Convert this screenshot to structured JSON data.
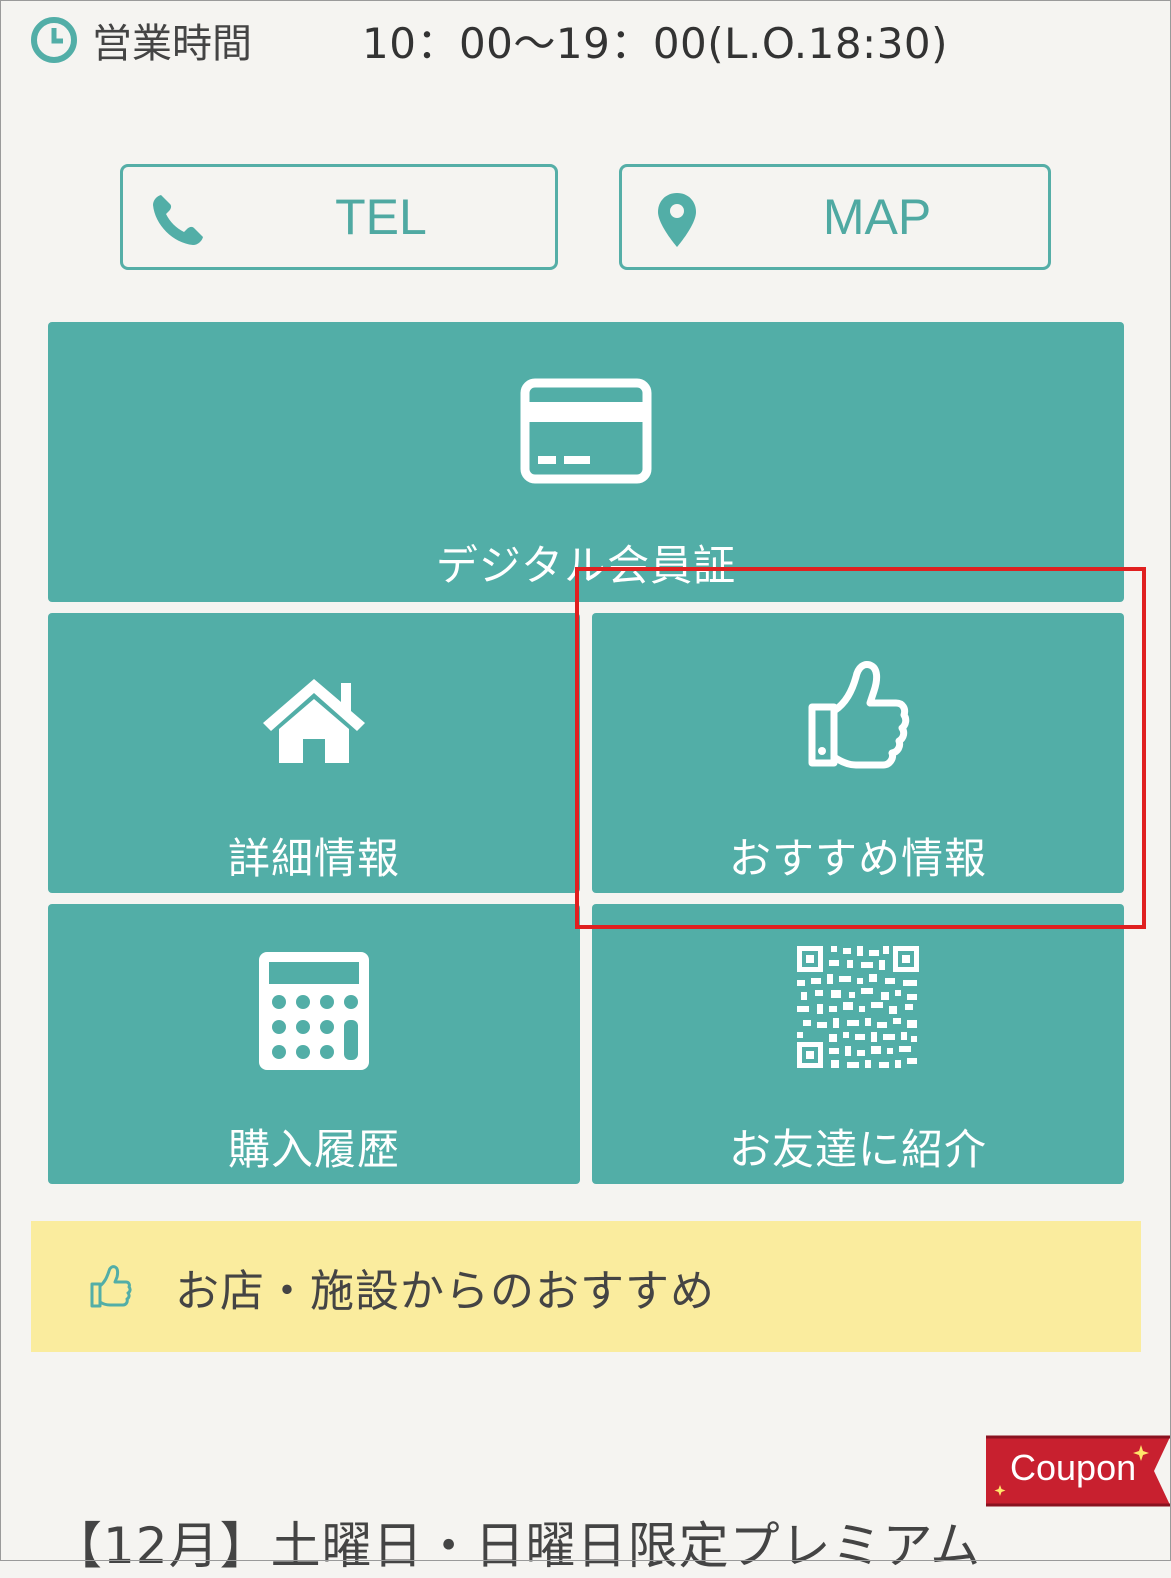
{
  "hours": {
    "label": "営業時間",
    "value": "10：00〜19：00(L.O.18:30)"
  },
  "buttons": {
    "tel_label": "TEL",
    "map_label": "MAP"
  },
  "tiles": {
    "card": "デジタル会員証",
    "details": "詳細情報",
    "recommend": "おすすめ情報",
    "history": "購入履歴",
    "friend": "お友達に紹介"
  },
  "banner": {
    "text": "お店・施設からのおすすめ"
  },
  "coupon": {
    "label": "Coupon"
  },
  "article": {
    "title": "【12月】土曜日・日曜日限定プレミアム"
  },
  "colors": {
    "accent": "#52aea7",
    "banner_bg": "#faec9e",
    "coupon_red": "#c8202f",
    "highlight": "#e02020"
  },
  "icons": [
    "clock-icon",
    "phone-icon",
    "map-pin-icon",
    "credit-card-icon",
    "home-icon",
    "thumbs-up-icon",
    "calculator-icon",
    "qr-code-icon"
  ]
}
